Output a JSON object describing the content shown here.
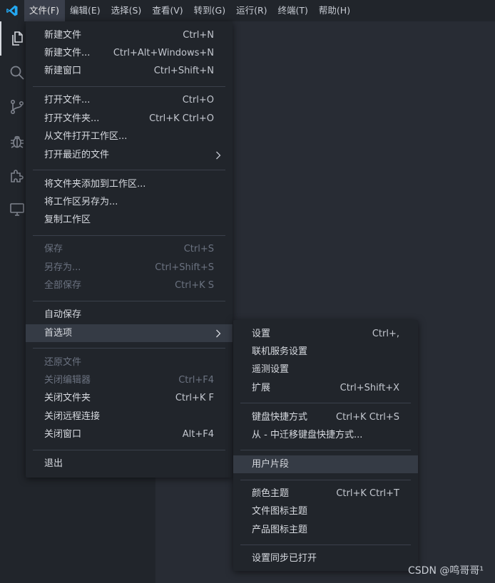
{
  "menubar": {
    "items": [
      "文件(F)",
      "编辑(E)",
      "选择(S)",
      "查看(V)",
      "转到(G)",
      "运行(R)",
      "终端(T)",
      "帮助(H)"
    ]
  },
  "activity_bar": {
    "icons": [
      "explorer-icon",
      "search-icon",
      "source-control-icon",
      "debug-icon",
      "extensions-icon",
      "remote-explorer-icon"
    ]
  },
  "file_menu": {
    "items": [
      {
        "label": "新建文件",
        "key": "Ctrl+N"
      },
      {
        "label": "新建文件...",
        "key": "Ctrl+Alt+Windows+N"
      },
      {
        "label": "新建窗口",
        "key": "Ctrl+Shift+N"
      },
      {
        "label": "打开文件...",
        "key": "Ctrl+O"
      },
      {
        "label": "打开文件夹...",
        "key": "Ctrl+K Ctrl+O"
      },
      {
        "label": "从文件打开工作区...",
        "key": ""
      },
      {
        "label": "打开最近的文件",
        "key": ""
      },
      {
        "label": "将文件夹添加到工作区...",
        "key": ""
      },
      {
        "label": "将工作区另存为...",
        "key": ""
      },
      {
        "label": "复制工作区",
        "key": ""
      },
      {
        "label": "保存",
        "key": "Ctrl+S"
      },
      {
        "label": "另存为...",
        "key": "Ctrl+Shift+S"
      },
      {
        "label": "全部保存",
        "key": "Ctrl+K S"
      },
      {
        "label": "自动保存",
        "key": ""
      },
      {
        "label": "首选项",
        "key": ""
      },
      {
        "label": "还原文件",
        "key": ""
      },
      {
        "label": "关闭编辑器",
        "key": "Ctrl+F4"
      },
      {
        "label": "关闭文件夹",
        "key": "Ctrl+K F"
      },
      {
        "label": "关闭远程连接",
        "key": ""
      },
      {
        "label": "关闭窗口",
        "key": "Alt+F4"
      },
      {
        "label": "退出",
        "key": ""
      }
    ]
  },
  "preferences_menu": {
    "items": [
      {
        "label": "设置",
        "key": "Ctrl+,"
      },
      {
        "label": "联机服务设置",
        "key": ""
      },
      {
        "label": "遥测设置",
        "key": ""
      },
      {
        "label": "扩展",
        "key": "Ctrl+Shift+X"
      },
      {
        "label": "键盘快捷方式",
        "key": "Ctrl+K Ctrl+S"
      },
      {
        "label": "从 - 中迁移键盘快捷方式...",
        "key": ""
      },
      {
        "label": "用户片段",
        "key": ""
      },
      {
        "label": "颜色主题",
        "key": "Ctrl+K Ctrl+T"
      },
      {
        "label": "文件图标主题",
        "key": ""
      },
      {
        "label": "产品图标主题",
        "key": ""
      },
      {
        "label": "设置同步已打开",
        "key": ""
      }
    ]
  },
  "watermark": "CSDN @鸣哥哥¹",
  "colors": {
    "menubar_bg": "#21252b",
    "editor_bg": "#282c34",
    "menu_bg": "#21252b",
    "hover_bg": "#353b45",
    "accent_logo": "#23a8f2"
  }
}
